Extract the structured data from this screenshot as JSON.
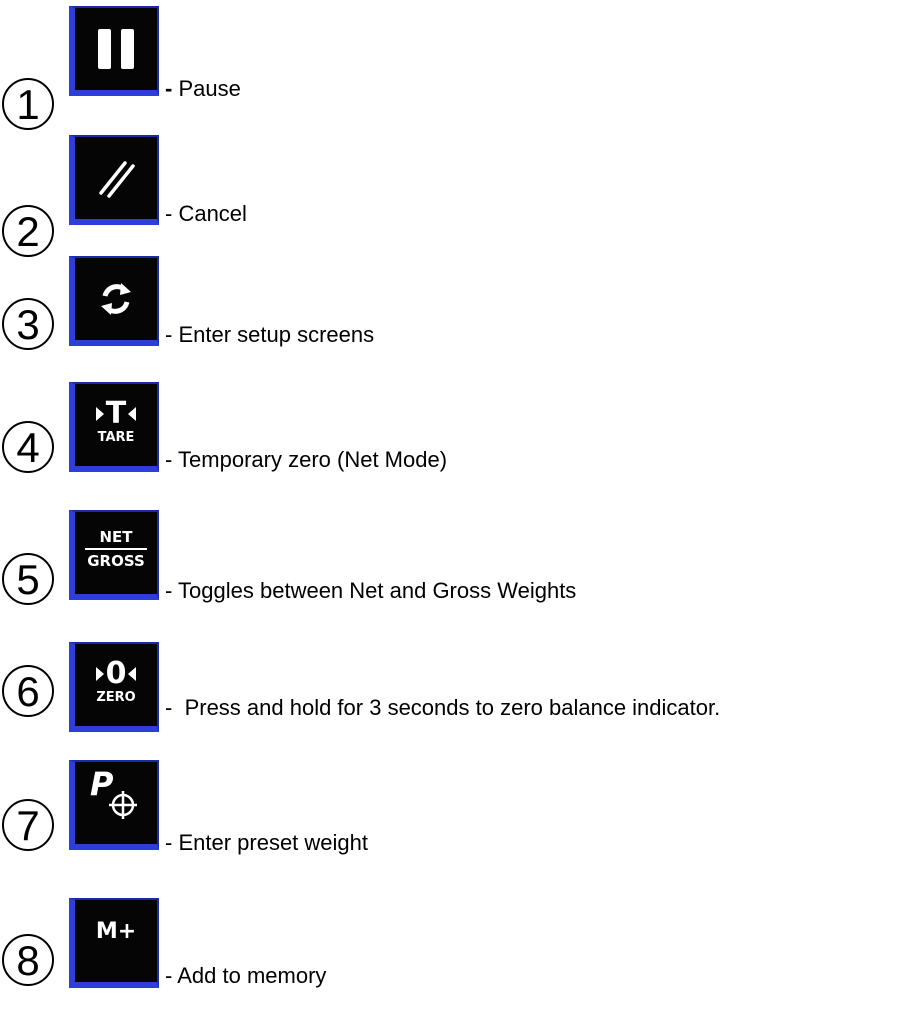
{
  "items": [
    {
      "number": "1",
      "icon": "pause-icon",
      "dash": "-",
      "label": "Pause"
    },
    {
      "number": "2",
      "icon": "cancel-slashes-icon",
      "dash": "-",
      "label": "Cancel"
    },
    {
      "number": "3",
      "icon": "setup-cycle-icon",
      "dash": "-",
      "label": "Enter setup screens"
    },
    {
      "number": "4",
      "icon": "tare-icon",
      "icon_text": "TARE",
      "icon_symbol": "T",
      "dash": "-",
      "label": "Temporary zero (Net Mode)"
    },
    {
      "number": "5",
      "icon": "net-gross-icon",
      "icon_top": "NET",
      "icon_bottom": "GROSS",
      "dash": "-",
      "label": "Toggles between Net and Gross Weights"
    },
    {
      "number": "6",
      "icon": "zero-icon",
      "icon_text": "ZERO",
      "icon_symbol": "0",
      "dash": "-",
      "label": "Press and hold for 3 seconds to zero balance indicator."
    },
    {
      "number": "7",
      "icon": "preset-weight-icon",
      "icon_symbol": "P",
      "dash": "-",
      "label": "Enter preset weight"
    },
    {
      "number": "8",
      "icon": "memory-add-icon",
      "icon_text": "M+",
      "dash": "-",
      "label": "Add to memory"
    }
  ],
  "colors": {
    "button_bg": "#050505",
    "button_border": "#2d3fd8",
    "icon_fg": "#ffffff"
  }
}
